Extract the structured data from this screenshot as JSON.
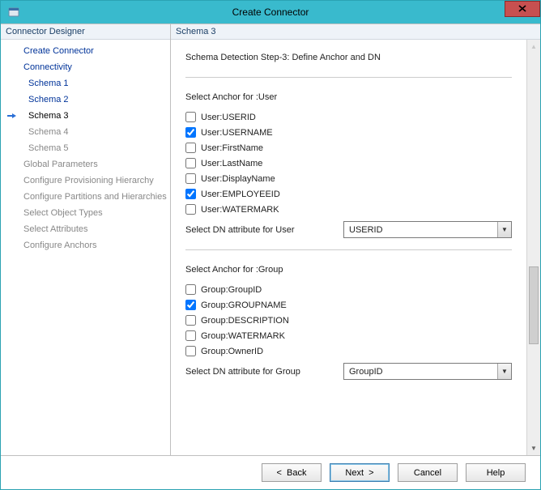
{
  "titlebar": {
    "title": "Create Connector"
  },
  "sidebar": {
    "header": "Connector Designer",
    "items": [
      {
        "label": "Create Connector",
        "state": "link"
      },
      {
        "label": "Connectivity",
        "state": "link"
      },
      {
        "label": "Schema 1",
        "state": "link",
        "sub": true
      },
      {
        "label": "Schema 2",
        "state": "link",
        "sub": true
      },
      {
        "label": "Schema 3",
        "state": "current",
        "sub": true
      },
      {
        "label": "Schema 4",
        "state": "disabled",
        "sub": true
      },
      {
        "label": "Schema 5",
        "state": "disabled",
        "sub": true
      },
      {
        "label": "Global Parameters",
        "state": "disabled"
      },
      {
        "label": "Configure Provisioning Hierarchy",
        "state": "disabled"
      },
      {
        "label": "Configure Partitions and Hierarchies",
        "state": "disabled"
      },
      {
        "label": "Select Object Types",
        "state": "disabled"
      },
      {
        "label": "Select Attributes",
        "state": "disabled"
      },
      {
        "label": "Configure Anchors",
        "state": "disabled"
      }
    ]
  },
  "main": {
    "header": "Schema 3",
    "step_title": "Schema Detection Step-3: Define Anchor and DN",
    "user": {
      "section_label": "Select Anchor for :User",
      "checks": [
        {
          "label": "User:USERID",
          "checked": false
        },
        {
          "label": "User:USERNAME",
          "checked": true
        },
        {
          "label": "User:FirstName",
          "checked": false
        },
        {
          "label": "User:LastName",
          "checked": false
        },
        {
          "label": "User:DisplayName",
          "checked": false
        },
        {
          "label": "User:EMPLOYEEID",
          "checked": true
        },
        {
          "label": "User:WATERMARK",
          "checked": false
        }
      ],
      "dn_label": "Select DN attribute for User",
      "dn_value": "USERID"
    },
    "group": {
      "section_label": "Select Anchor for :Group",
      "checks": [
        {
          "label": "Group:GroupID",
          "checked": false
        },
        {
          "label": "Group:GROUPNAME",
          "checked": true
        },
        {
          "label": "Group:DESCRIPTION",
          "checked": false
        },
        {
          "label": "Group:WATERMARK",
          "checked": false
        },
        {
          "label": "Group:OwnerID",
          "checked": false
        }
      ],
      "dn_label": "Select DN attribute for Group",
      "dn_value": "GroupID"
    }
  },
  "footer": {
    "back": "<  Back",
    "next": "Next  >",
    "cancel": "Cancel",
    "help": "Help"
  }
}
